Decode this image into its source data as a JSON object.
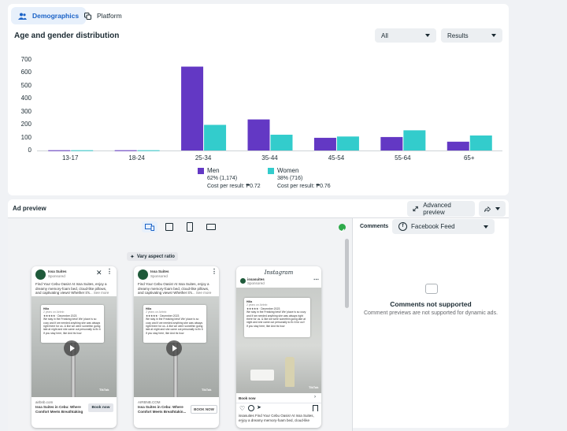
{
  "tabs": [
    {
      "label": "Demographics",
      "icon": "people-icon",
      "active": true
    },
    {
      "label": "Platform",
      "icon": "copy-icon",
      "active": false
    }
  ],
  "chart_section": {
    "title": "Age and gender distribution",
    "filter_all": "All",
    "filter_results": "Results"
  },
  "chart_data": {
    "type": "bar",
    "title": "Age and gender distribution",
    "categories": [
      "13-17",
      "18-24",
      "25-34",
      "35-44",
      "45-54",
      "55-64",
      "65+"
    ],
    "series": [
      {
        "name": "Men",
        "color": "#6338c4",
        "values": [
          2,
          2,
          648,
          240,
          98,
          104,
          68
        ]
      },
      {
        "name": "Women",
        "color": "#33cccc",
        "values": [
          2,
          2,
          198,
          122,
          108,
          156,
          116
        ]
      }
    ],
    "yticks": [
      0,
      100,
      200,
      300,
      400,
      500,
      600,
      700
    ],
    "ylim": [
      0,
      700
    ],
    "legend": [
      {
        "name": "Men",
        "share": "62% (1,174)",
        "cost": "Cost per result: ₱0.72"
      },
      {
        "name": "Women",
        "share": "38% (716)",
        "cost": "Cost per result: ₱0.76"
      }
    ],
    "legend_position": "bottom"
  },
  "ad_preview": {
    "title": "Ad preview",
    "advanced_label": "Advanced preview",
    "vary_label": "Vary aspect ratio",
    "comments_label": "Comments",
    "comments_select": "Facebook Feed",
    "not_supported_title": "Comments not supported",
    "not_supported_desc": "Comment previews are not supported for dynamic ads."
  },
  "ads": {
    "page_name": "Issa Suites",
    "sponsored": "Sponsored",
    "body": "Find Your Cebu Oasis! At Issa Suites, enjoy a dreamy memory-foam bed, cloud-like pillows, and captivating views! Whether it's",
    "see_more": "... See more",
    "ad1_domain": "airbnb.com",
    "ad1_headline": "Issa Suites in Cebu: Where Comfort Meets Breathtaking",
    "ad1_cta": "Book now",
    "ad2_domain": "AIRBNB.COM",
    "ad2_headline": "Issa Suites in Cebu: Where Comfort Meets Breathtakin...",
    "ad2_cta": "BOOK NOW",
    "ig_brand": "Instagram",
    "ig_account": "issasuites",
    "ig_cta": "Book now",
    "ig_caption": "issasuites Find Your Cebu Oasis! At Issa Suites, enjoy a dreamy memory-foam bed, cloud-like pillows,",
    "review_name": "Hilia",
    "review_date": "2 years on Airbnb",
    "review_stars": "★★★★★ · December 2023",
    "review_text": "We stay in the Freaking best! We' place is so cozy and if we needed anything she was always right there for us. & like we were somethin going late at night and she came out personally to fix it for us!! Every ok 😃",
    "review_more": "If you stay here, like And its how",
    "tiktok": "TikTok"
  }
}
